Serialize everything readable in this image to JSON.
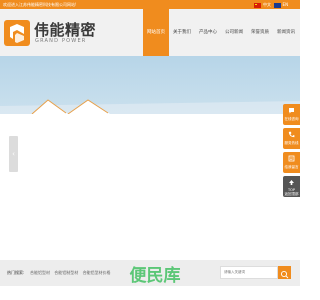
{
  "topbar": {
    "welcome": "欢迎进入江苏伟能精密科技有限公司网站!",
    "lang_cn": "中文",
    "lang_en": "EN"
  },
  "brand": {
    "name_cn": "伟能精密",
    "name_en": "GRAND POWER",
    "logo_icon": "gp-logo-icon"
  },
  "nav": {
    "items": [
      {
        "label": "网站首页",
        "active": true
      },
      {
        "label": "关于我们",
        "active": false
      },
      {
        "label": "产品中心",
        "active": false
      },
      {
        "label": "公司新闻",
        "active": false
      },
      {
        "label": "荣誉资质",
        "active": false
      },
      {
        "label": "新闻资讯",
        "active": false
      }
    ]
  },
  "banner": {
    "prev_glyph": "‹"
  },
  "float_panel": {
    "items": [
      {
        "label": "在线咨询",
        "icon": "chat-icon"
      },
      {
        "label": "服务热线",
        "icon": "phone-icon"
      },
      {
        "label": "给我留言",
        "icon": "message-icon"
      },
      {
        "label": "TOP\n返回顶部",
        "icon": "arrow-up-icon"
      }
    ]
  },
  "footer": {
    "hot_label": "热门搜索:",
    "hot_links": [
      "合能铝型材",
      "合能铝制型材",
      "合能铝型材价格"
    ],
    "search_placeholder": "请输入关键词"
  },
  "watermark": {
    "text": "便民库"
  },
  "colors": {
    "accent": "#f08c1e",
    "header_bg": "#f1f1f1",
    "footer_bg": "#ededed"
  }
}
